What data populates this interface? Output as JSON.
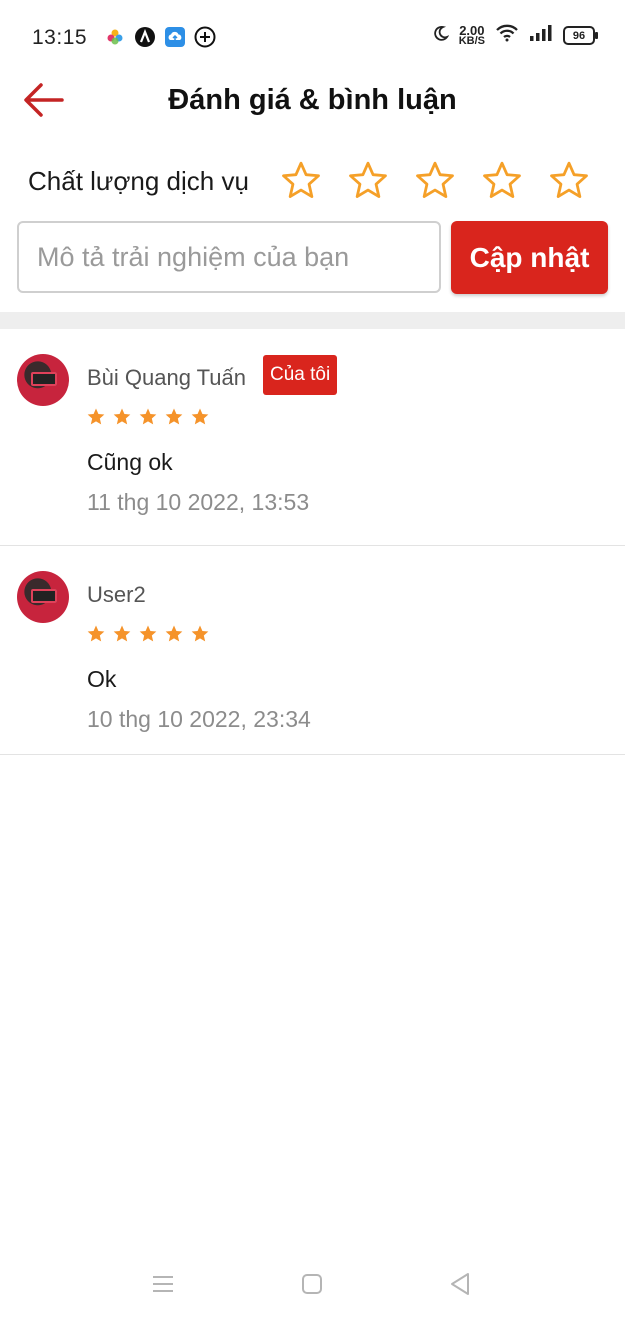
{
  "status_bar": {
    "time": "13:15",
    "net_speed_value": "2.00",
    "net_speed_unit": "KB/S",
    "battery": "96",
    "icons": [
      "photos-icon",
      "app-a-icon",
      "cloud-upload-icon",
      "add-circle-icon",
      "moon-icon",
      "wifi-icon",
      "signal-icon",
      "battery-icon"
    ]
  },
  "header": {
    "title": "Đánh giá & bình luận",
    "back_icon": "arrow-left-icon"
  },
  "rating": {
    "label": "Chất lượng dịch vụ",
    "stars_total": 5,
    "stars_selected": 0
  },
  "review_form": {
    "placeholder": "Mô tả trải nghiệm của bạn",
    "value": "",
    "submit_label": "Cập nhật"
  },
  "reviews": [
    {
      "name": "Bùi Quang Tuấn",
      "badge": "Của tôi",
      "rating": 5,
      "text": "Cũng ok",
      "date": "11 thg 10 2022, 13:53"
    },
    {
      "name": "User2",
      "badge": "",
      "rating": 5,
      "text": "Ok",
      "date": "10 thg 10 2022, 23:34"
    }
  ],
  "colors": {
    "accent": "#d9251d",
    "star_outline": "#f5a028",
    "star_fill": "#f5932a",
    "divider": "#eeeeee"
  },
  "nav_bar": {
    "icons": [
      "menu-icon",
      "home-square-icon",
      "back-triangle-icon"
    ]
  }
}
